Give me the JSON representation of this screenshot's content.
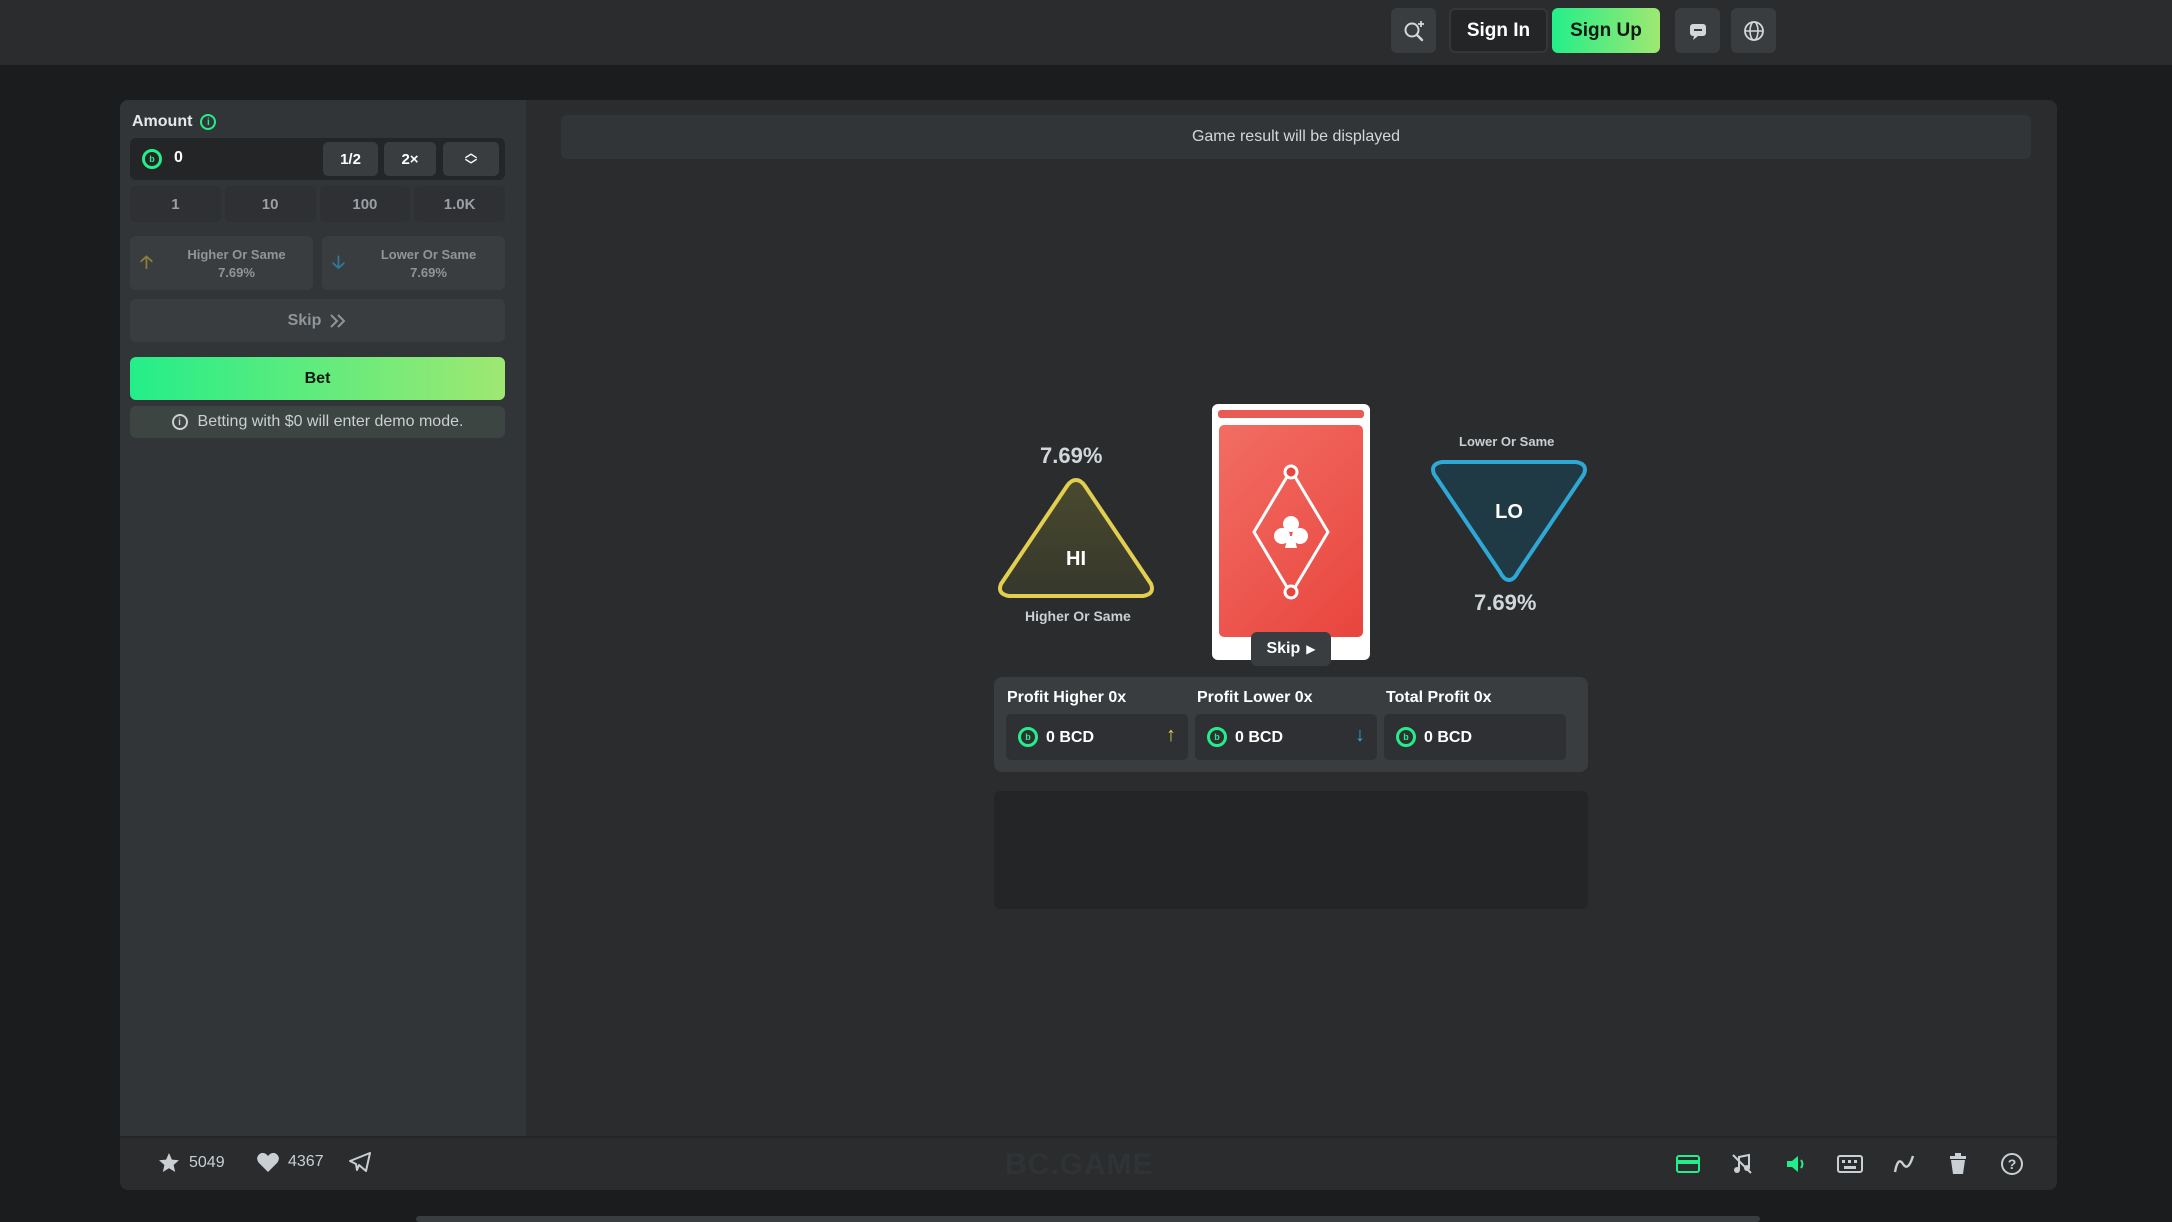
{
  "header": {
    "signin_label": "Sign In",
    "signup_label": "Sign Up",
    "search_icon": "search-icon",
    "chat_icon": "chat-icon",
    "globe_icon": "globe-icon"
  },
  "sidebar": {
    "amount_label": "Amount",
    "amount_value": "0",
    "half_label": "1/2",
    "double_label": "2×",
    "quick_amounts": [
      "1",
      "10",
      "100",
      "1.0K"
    ],
    "higher": {
      "label": "Higher Or Same",
      "pct": "7.69%"
    },
    "lower": {
      "label": "Lower Or Same",
      "pct": "7.69%"
    },
    "skip_label": "Skip",
    "bet_label": "Bet",
    "demo_note": "Betting with $0 will enter demo mode."
  },
  "game": {
    "result_text": "Game result will be displayed",
    "hi": {
      "pct": "7.69%",
      "symbol": "HI",
      "label": "Higher Or Same"
    },
    "lo": {
      "pct": "7.69%",
      "symbol": "LO",
      "label": "Lower Or Same"
    },
    "card_skip": "Skip",
    "profit": {
      "higher_title": "Profit Higher 0x",
      "higher_value": "0 BCD",
      "lower_title": "Profit Lower 0x",
      "lower_value": "0 BCD",
      "total_title": "Total Profit 0x",
      "total_value": "0 BCD"
    }
  },
  "footer": {
    "stars_count": "5049",
    "likes_count": "4367",
    "brand": "BC.GAME"
  },
  "colors": {
    "accent": "#24ee89",
    "hi": "#e2cf50",
    "lo": "#2fa8d6",
    "card": "#ee5a52"
  }
}
